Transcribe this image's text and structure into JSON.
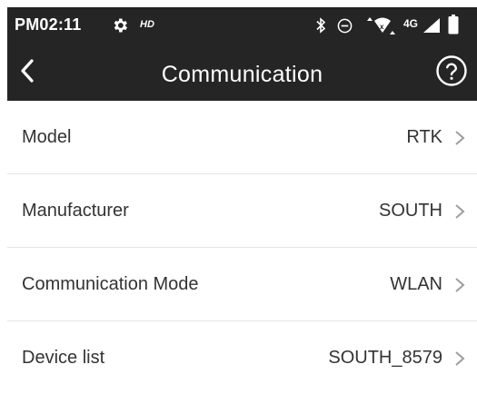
{
  "status_bar": {
    "time": "PM02:11",
    "hd_label": "HD",
    "network_label": "4G",
    "icons": [
      "gear-icon",
      "bluetooth-icon",
      "do-not-disturb-icon",
      "wifi-icon",
      "signal-icon",
      "battery-icon"
    ]
  },
  "app_bar": {
    "title": "Communication",
    "back_icon": "back-arrow-icon",
    "help_icon": "help-circle-icon"
  },
  "settings": [
    {
      "label": "Model",
      "value": "RTK"
    },
    {
      "label": "Manufacturer",
      "value": "SOUTH"
    },
    {
      "label": "Communication Mode",
      "value": "WLAN"
    },
    {
      "label": "Device list",
      "value": "SOUTH_8579"
    }
  ],
  "colors": {
    "header_bg": "#252525",
    "header_text": "#ffffff",
    "row_text": "#333333",
    "chevron": "#9e9e9e",
    "divider": "#e6e6e6"
  }
}
